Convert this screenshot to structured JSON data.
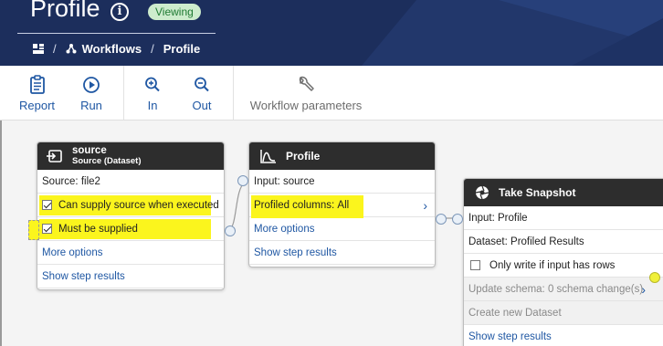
{
  "header": {
    "title": "Profile",
    "badge": "Viewing",
    "breadcrumb": [
      {
        "label": "Workflows"
      },
      {
        "label": "Profile"
      }
    ],
    "separator": "/"
  },
  "toolbar": {
    "buttons": [
      {
        "label": "Report",
        "icon": "clipboard-icon"
      },
      {
        "label": "Run",
        "icon": "play-circle-icon"
      },
      {
        "label": "In",
        "icon": "zoom-in-icon"
      },
      {
        "label": "Out",
        "icon": "zoom-out-icon"
      },
      {
        "label": "Workflow parameters",
        "icon": "wrench-icon"
      }
    ]
  },
  "nodes": {
    "source": {
      "title": "source",
      "subtitle": "Source (Dataset)",
      "source_label": "Source:",
      "source_value": "file2",
      "checkbox1": "Can supply source when executed",
      "checkbox2": "Must be supplied",
      "more_options": "More options",
      "show_results": "Show step results"
    },
    "profile": {
      "title": "Profile",
      "input_label": "Input:",
      "input_value": "source",
      "profiled_label": "Profiled columns:",
      "profiled_value": "All",
      "more_options": "More options",
      "show_results": "Show step results"
    },
    "snapshot": {
      "title": "Take Snapshot",
      "input_label": "Input:",
      "input_value": "Profile",
      "dataset_label": "Dataset:",
      "dataset_value": "Profiled Results",
      "only_write": "Only write if input has rows",
      "update_schema_label": "Update schema:",
      "update_schema_value": "0 schema change(s)",
      "create_dataset": "Create new Dataset",
      "show_results": "Show step results"
    }
  },
  "colors": {
    "header_bg": "#1c2e5c",
    "accent": "#1f57a3",
    "highlight": "#fbf51d",
    "node_header": "#2d2d2d"
  }
}
